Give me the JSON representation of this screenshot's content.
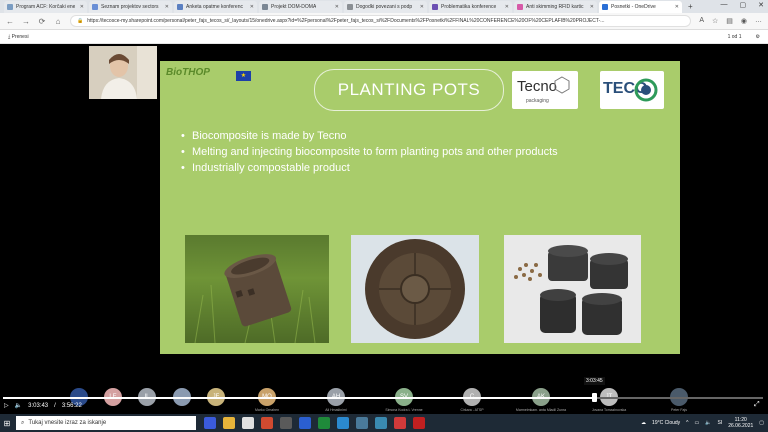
{
  "browser": {
    "tabs": [
      {
        "label": "Program ACF: Korčaki ene",
        "color": "#7a9cc2"
      },
      {
        "label": "Seznam projektov sectors",
        "color": "#6a8fd6"
      },
      {
        "label": "Anketa opatme konferenc",
        "color": "#5a7fc1"
      },
      {
        "label": "Projekt DOM-DOMA",
        "color": "#7b8794"
      },
      {
        "label": "Dogodki povezani s podp",
        "color": "#8a8f94"
      },
      {
        "label": "Problematika konference ",
        "color": "#6b4fb3"
      },
      {
        "label": "Anti skimming RFID kartic",
        "color": "#d65aa8"
      },
      {
        "label": "Posnetki - OneDrive",
        "color": "#2a6fd6",
        "active": true
      }
    ],
    "new_tab": "+",
    "url": "https://tecosce-my.sharepoint.com/personal/peter_fajs_tecos_si/_layouts/15/onedrive.aspx?id=%2Fpersonal%2Fpeter_fajs_tecos_si%2FDocuments%2FPosnetki%2FFINAL%20CONFERENCE%20OF%20CEPLAFIB%20PROJECT-..."
  },
  "pdf": {
    "download_label": "Prenesi",
    "page": "1 od 1"
  },
  "slide": {
    "logo_text": "BioTHOP",
    "title": "PLANTING POTS",
    "tecno_name": "Tecno",
    "tecno_sub": "packaging",
    "teco_name": "TECO",
    "bullets": [
      "Biocomposite is made by Tecno",
      "Melting and injecting biocomposite to form planting pots and other products",
      "Industrially compostable product"
    ]
  },
  "participants": [
    {
      "initials": "",
      "color": "#2a4a8a"
    },
    {
      "initials": "LE",
      "color": "#d4a0a0"
    },
    {
      "initials": "IL",
      "color": "#9aa0a8"
    },
    {
      "initials": "",
      "color": "#8a9ab0"
    },
    {
      "initials": "JF",
      "color": "#c8b37a"
    },
    {
      "initials": "MO",
      "color": "#c9a26a",
      "name": "Marko Omahen"
    },
    {
      "initials": "AH",
      "color": "#9aa0a8",
      "name": "Ali Hmaštnimi"
    },
    {
      "initials": "SV",
      "color": "#8ab08a",
      "name": "Simona Kodra Ŀ Vrenne"
    },
    {
      "initials": "C",
      "color": "#b0b0b0",
      "name": "Cirkara - ATSP"
    },
    {
      "initials": "AK",
      "color": "#8aa08a",
      "name": "Marmelmkam. anta Mladil Zunra"
    },
    {
      "initials": "JT",
      "color": "#bdbdbd",
      "name": "Jovana Tomazinovska"
    },
    {
      "initials": "",
      "color": "#4a5a6a",
      "name": "Peter Fajs"
    }
  ],
  "player": {
    "current_time": "3:03:43",
    "duration": "3:56:22",
    "hover_time": "3:03:45",
    "progress": 0.777
  },
  "taskbar": {
    "search_placeholder": "Tukaj vnesite izraz za iskanje",
    "weather": "19°C Cloudy",
    "time": "11:20",
    "date": "26.06.2021",
    "lang": "SI",
    "app_colors": [
      "#3b5bdb",
      "#e7b43a",
      "#e0e0e0",
      "#d04a30",
      "#5a5a5a",
      "#2b5fd0",
      "#1f8a3a",
      "#2b8ad0",
      "#4a7a9a",
      "#3a8ab0",
      "#d03a3a",
      "#c02020"
    ]
  }
}
